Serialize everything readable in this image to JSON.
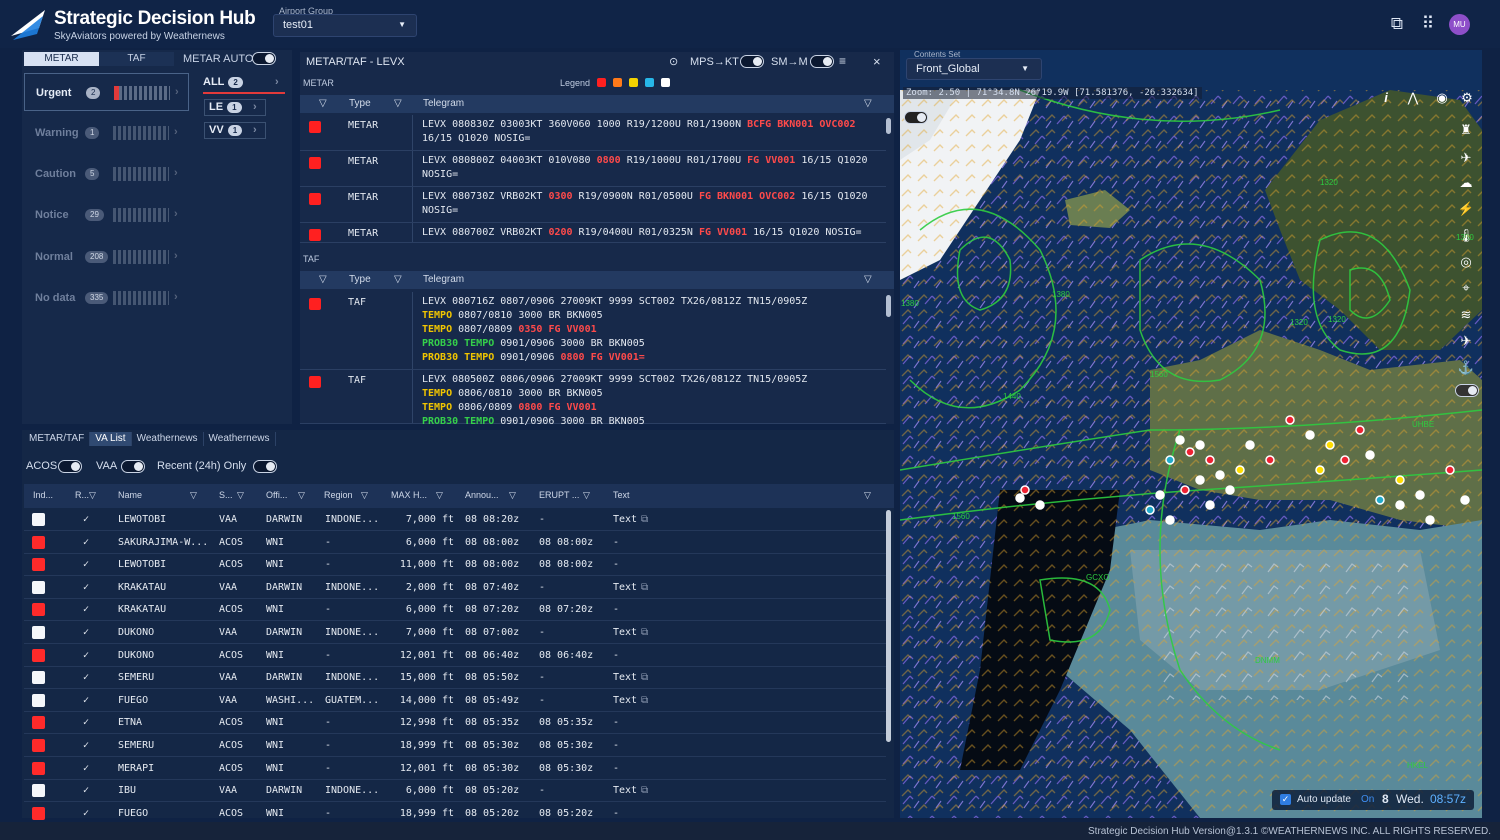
{
  "header": {
    "title": "Strategic Decision Hub",
    "subtitle": "SkyAviators powered by Weathernews",
    "airport_group_label": "Airport Group",
    "airport_group_value": "test01",
    "avatar": "MU",
    "icons": [
      "screenshot-icon",
      "apps-grid-icon"
    ]
  },
  "left": {
    "tabs": [
      "METAR",
      "TAF"
    ],
    "auto_label": "METAR AUTO",
    "categories": [
      {
        "name": "Urgent",
        "count": "2"
      },
      {
        "name": "Warning",
        "count": "1"
      },
      {
        "name": "Caution",
        "count": "5"
      },
      {
        "name": "Notice",
        "count": "29"
      },
      {
        "name": "Normal",
        "count": "208"
      },
      {
        "name": "No data",
        "count": "335"
      }
    ],
    "chips": [
      {
        "label": "ALL",
        "count": "2"
      },
      {
        "label": "LE",
        "count": "1"
      },
      {
        "label": "VV",
        "count": "1"
      }
    ]
  },
  "metar": {
    "title": "METAR/TAF - LEVX",
    "mps_label": "MPS→KT",
    "sm_label": "SM→M",
    "section_metar": "METAR",
    "section_taf": "TAF",
    "legend_label": "Legend",
    "legend_colors": [
      "#ff2020",
      "#ff7a1a",
      "#f3d200",
      "#27b7e8",
      "#ffffff"
    ],
    "col_type": "Type",
    "col_telegram": "Telegram",
    "rows": [
      {
        "type": "METAR",
        "parts": [
          [
            "LEVX 080830Z 03003KT 360V060 1000 R19/1200U R01/1900N ",
            ""
          ],
          [
            "BCFG BKN001 OVC002",
            "red"
          ],
          [
            "\n16/15 Q1020 NOSIG=",
            ""
          ]
        ]
      },
      {
        "type": "METAR",
        "parts": [
          [
            "LEVX 080800Z 04003KT 010V080 ",
            ""
          ],
          [
            "0800",
            "red"
          ],
          [
            " R19/1000U R01/1700U ",
            ""
          ],
          [
            "FG VV001",
            "red"
          ],
          [
            " 16/15 Q1020\nNOSIG=",
            ""
          ]
        ]
      },
      {
        "type": "METAR",
        "parts": [
          [
            "LEVX 080730Z VRB02KT ",
            ""
          ],
          [
            "0300",
            "red"
          ],
          [
            " R19/0900N R01/0500U ",
            ""
          ],
          [
            "FG BKN001 OVC002",
            "red"
          ],
          [
            " 16/15 Q1020\nNOSIG=",
            ""
          ]
        ]
      },
      {
        "type": "METAR",
        "parts": [
          [
            "LEVX 080700Z VRB02KT ",
            ""
          ],
          [
            "0200",
            "red"
          ],
          [
            " R19/0400U R01/0325N ",
            ""
          ],
          [
            "FG VV001",
            "red"
          ],
          [
            " 16/15 Q1020 NOSIG=",
            ""
          ]
        ]
      }
    ],
    "taf_rows": [
      {
        "type": "TAF",
        "parts": [
          [
            "LEVX 080716Z 0807/0906 27009KT 9999 SCT002 TX26/0812Z TN15/0905Z\n",
            ""
          ],
          [
            "TEMPO",
            "yel"
          ],
          [
            " 0807/0810 3000 BR BKN005\n",
            ""
          ],
          [
            "TEMPO",
            "yel"
          ],
          [
            " 0807/0809 ",
            ""
          ],
          [
            "0350 FG VV001",
            "red"
          ],
          [
            "\n",
            ""
          ],
          [
            "PROB30 TEMPO",
            "grn"
          ],
          [
            " 0901/0906 3000 BR BKN005\n",
            ""
          ],
          [
            "PROB30 TEMPO",
            "yel"
          ],
          [
            " 0901/0906 ",
            ""
          ],
          [
            "0800 FG VV001=",
            "red"
          ]
        ]
      },
      {
        "type": "TAF",
        "parts": [
          [
            "LEVX 080500Z 0806/0906 27009KT 9999 SCT002 TX26/0812Z TN15/0905Z\n",
            ""
          ],
          [
            "TEMPO",
            "yel"
          ],
          [
            " 0806/0810 3000 BR BKN005\n",
            ""
          ],
          [
            "TEMPO",
            "yel"
          ],
          [
            " 0806/0809 ",
            ""
          ],
          [
            "0800 FG VV001",
            "red"
          ],
          [
            "\n",
            ""
          ],
          [
            "PROB30 TEMPO",
            "grn"
          ],
          [
            " 0901/0906 3000 BR BKN005",
            ""
          ]
        ]
      }
    ]
  },
  "list": {
    "tabs": [
      "METAR/TAF",
      "VA List",
      "Weathernews",
      "Weathernews"
    ],
    "filters": {
      "acos": "ACOS",
      "vaa": "VAA",
      "recent": "Recent (24h) Only"
    },
    "headers": [
      "Ind...",
      "R...",
      "Name",
      "S...",
      "Offi...",
      "Region",
      "MAX H...",
      "Annou...",
      "ERUPT ...",
      "Text"
    ],
    "rows": [
      {
        "ind": "w",
        "name": "LEWOTOBI",
        "s": "VAA",
        "off": "DARWIN",
        "reg": "INDONE...",
        "max": "7,000 ft",
        "ann": "08 08:20z",
        "eru": "-",
        "txt": "Text"
      },
      {
        "ind": "r",
        "name": "SAKURAJIMA-W...",
        "s": "ACOS",
        "off": "WNI",
        "reg": "-",
        "max": "6,000 ft",
        "ann": "08 08:00z",
        "eru": "08 08:00z",
        "txt": "-"
      },
      {
        "ind": "r",
        "name": "LEWOTOBI",
        "s": "ACOS",
        "off": "WNI",
        "reg": "-",
        "max": "11,000 ft",
        "ann": "08 08:00z",
        "eru": "08 08:00z",
        "txt": "-"
      },
      {
        "ind": "w",
        "name": "KRAKATAU",
        "s": "VAA",
        "off": "DARWIN",
        "reg": "INDONE...",
        "max": "2,000 ft",
        "ann": "08 07:40z",
        "eru": "-",
        "txt": "Text"
      },
      {
        "ind": "r",
        "name": "KRAKATAU",
        "s": "ACOS",
        "off": "WNI",
        "reg": "-",
        "max": "6,000 ft",
        "ann": "08 07:20z",
        "eru": "08 07:20z",
        "txt": "-"
      },
      {
        "ind": "w",
        "name": "DUKONO",
        "s": "VAA",
        "off": "DARWIN",
        "reg": "INDONE...",
        "max": "7,000 ft",
        "ann": "08 07:00z",
        "eru": "-",
        "txt": "Text"
      },
      {
        "ind": "r",
        "name": "DUKONO",
        "s": "ACOS",
        "off": "WNI",
        "reg": "-",
        "max": "12,001 ft",
        "ann": "08 06:40z",
        "eru": "08 06:40z",
        "txt": "-"
      },
      {
        "ind": "w",
        "name": "SEMERU",
        "s": "VAA",
        "off": "DARWIN",
        "reg": "INDONE...",
        "max": "15,000 ft",
        "ann": "08 05:50z",
        "eru": "-",
        "txt": "Text"
      },
      {
        "ind": "w",
        "name": "FUEGO",
        "s": "VAA",
        "off": "WASHI...",
        "reg": "GUATEM...",
        "max": "14,000 ft",
        "ann": "08 05:49z",
        "eru": "-",
        "txt": "Text"
      },
      {
        "ind": "r",
        "name": "ETNA",
        "s": "ACOS",
        "off": "WNI",
        "reg": "-",
        "max": "12,998 ft",
        "ann": "08 05:35z",
        "eru": "08 05:35z",
        "txt": "-"
      },
      {
        "ind": "r",
        "name": "SEMERU",
        "s": "ACOS",
        "off": "WNI",
        "reg": "-",
        "max": "18,999 ft",
        "ann": "08 05:30z",
        "eru": "08 05:30z",
        "txt": "-"
      },
      {
        "ind": "r",
        "name": "MERAPI",
        "s": "ACOS",
        "off": "WNI",
        "reg": "-",
        "max": "12,001 ft",
        "ann": "08 05:30z",
        "eru": "08 05:30z",
        "txt": "-"
      },
      {
        "ind": "w",
        "name": "IBU",
        "s": "VAA",
        "off": "DARWIN",
        "reg": "INDONE...",
        "max": "6,000 ft",
        "ann": "08 05:20z",
        "eru": "-",
        "txt": "Text"
      },
      {
        "ind": "r",
        "name": "FUEGO",
        "s": "ACOS",
        "off": "WNI",
        "reg": "-",
        "max": "18,999 ft",
        "ann": "08 05:20z",
        "eru": "08 05:20z",
        "txt": "-"
      }
    ]
  },
  "map": {
    "contents_label": "Contents Set",
    "contents_value": "Front_Global",
    "zoom_text": "Zoom: 2.50 | 71°34.8N    26°19.9W [71.581376, -26.332634]",
    "auto_update": "Auto update",
    "on": "On",
    "day": "8",
    "weekday": "Wed.",
    "time": "08:57z",
    "labels": [
      "1380",
      "1320",
      "1380",
      "1380",
      "1320",
      "1320",
      "1440",
      "1560",
      "GCXO",
      "HKEL",
      "DNMM",
      "UHBE",
      "1560"
    ]
  },
  "status": "Strategic Decision Hub  Version@1.3.1  ©WEATHERNEWS INC. ALL RIGHTS RESERVED."
}
